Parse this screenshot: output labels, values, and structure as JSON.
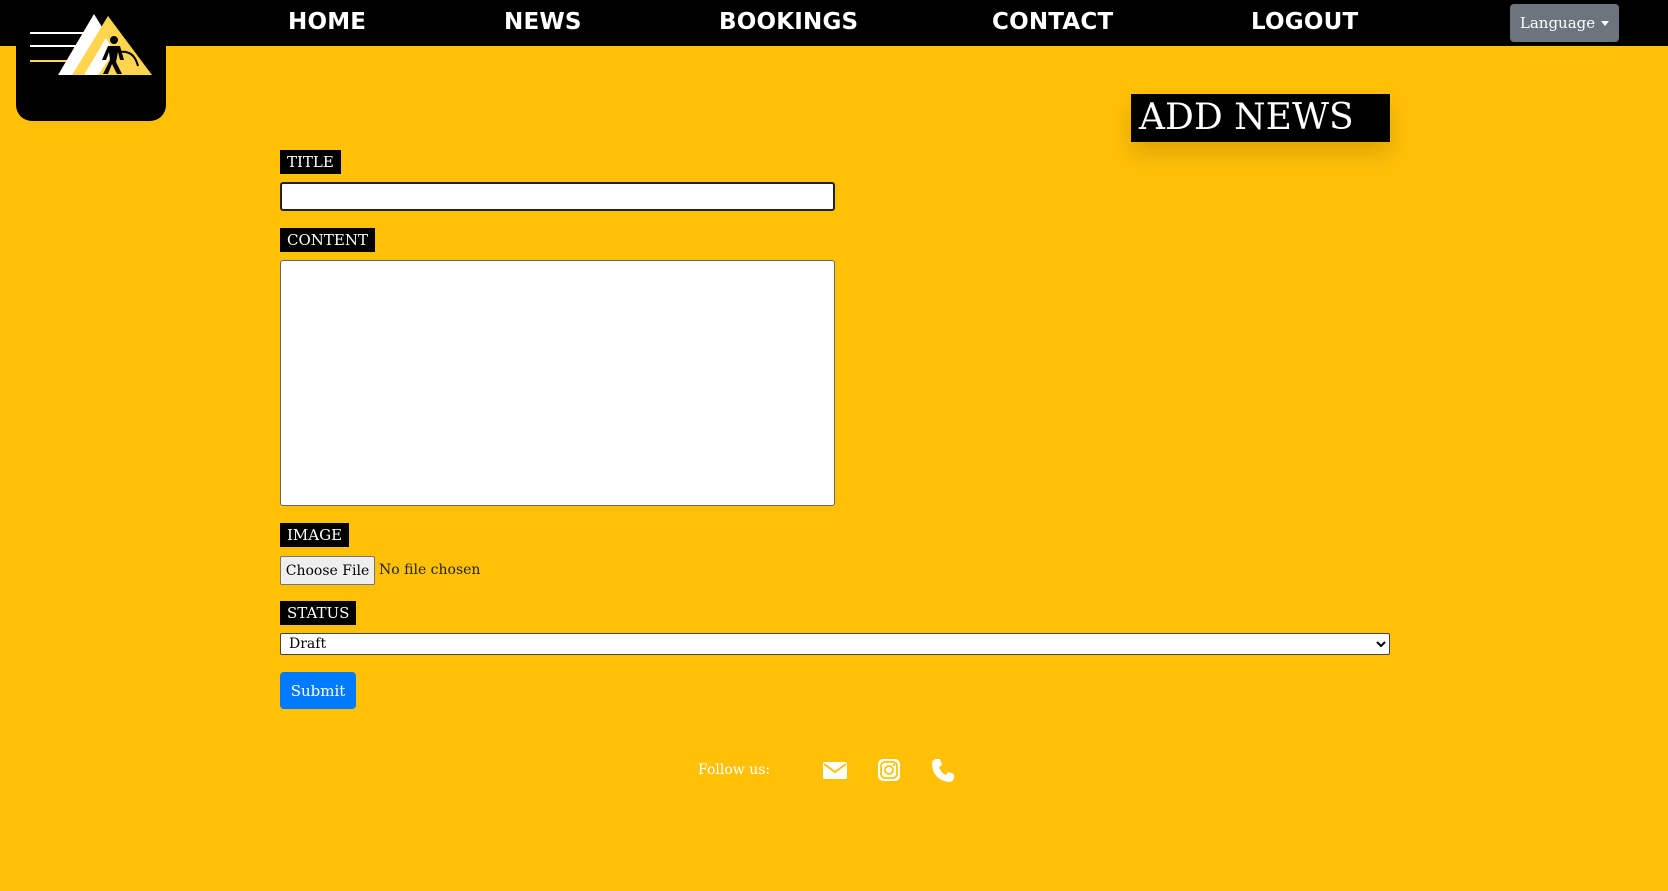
{
  "nav": {
    "links": [
      {
        "label": "HOME"
      },
      {
        "label": "NEWS"
      },
      {
        "label": "BOOKINGS"
      },
      {
        "label": "CONTACT"
      },
      {
        "label": "LOGOUT"
      }
    ],
    "language_label": "Language"
  },
  "page": {
    "heading": "ADD NEWS"
  },
  "form": {
    "title_label": "TITLE",
    "title_value": "",
    "content_label": "CONTENT",
    "content_value": "",
    "image_label": "IMAGE",
    "choose_file_label": "Choose File",
    "file_status": "No file chosen",
    "status_label": "STATUS",
    "status_selected": "Draft",
    "submit_label": "Submit"
  },
  "footer": {
    "follow_label": "Follow us:",
    "icons": [
      "envelope-icon",
      "instagram-icon",
      "phone-icon"
    ]
  },
  "colors": {
    "background": "#FFC107",
    "navbar": "#000000",
    "submit": "#007bff",
    "language_button": "#6c757d",
    "logo_accent": "#FFD54F"
  }
}
